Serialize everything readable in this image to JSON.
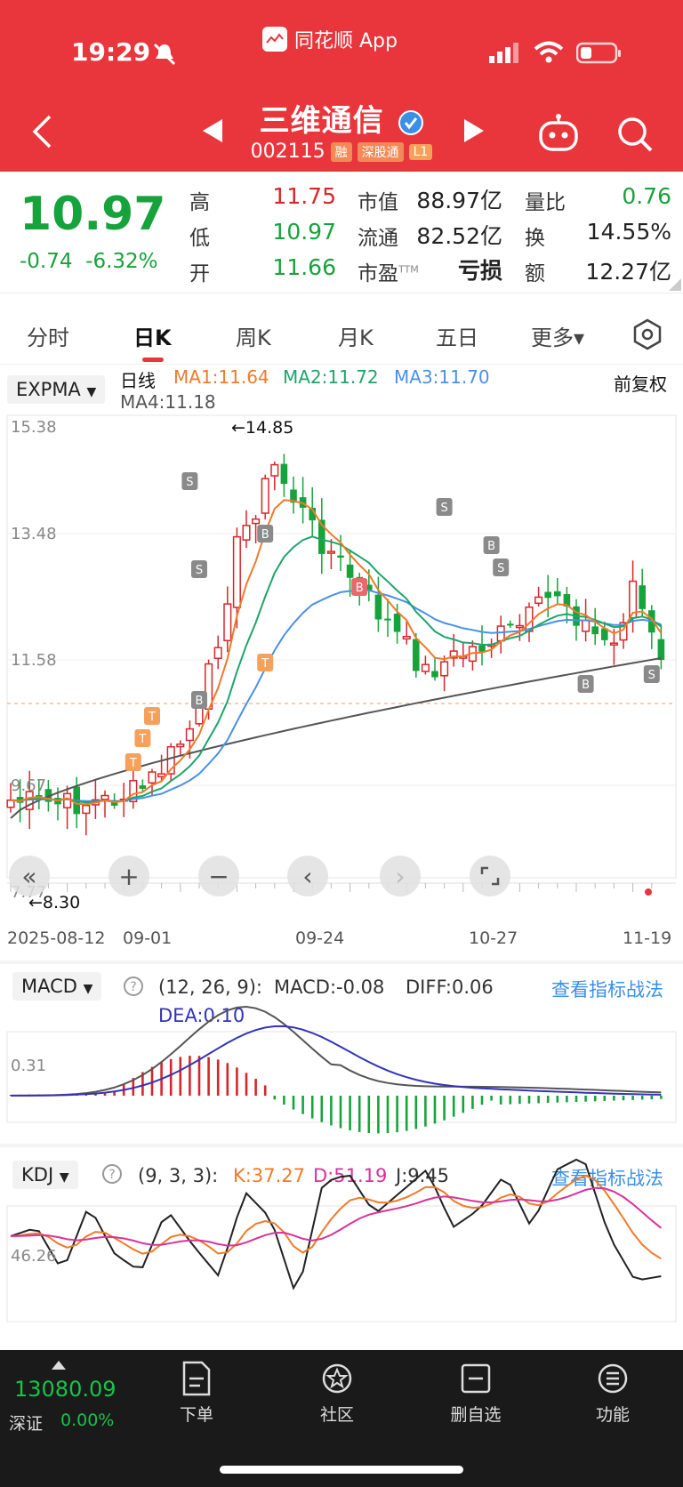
{
  "status": {
    "time": "19:29",
    "app": "同花顺 App"
  },
  "header": {
    "title": "三维通信",
    "code": "002115",
    "tags": [
      "融",
      "深股通",
      "L1"
    ]
  },
  "quote": {
    "price": "10.97",
    "change": "-0.74",
    "change_pct": "-6.32%",
    "high_label": "高",
    "high": "11.75",
    "low_label": "低",
    "low": "10.97",
    "open_label": "开",
    "open": "11.66",
    "mcap_label": "市值",
    "mcap": "88.97亿",
    "float_label": "流通",
    "float": "82.52亿",
    "pe_label": "市盈",
    "pe_sup": "TTM",
    "pe": "亏损",
    "vr_label": "量比",
    "vr": "0.76",
    "turnover_label": "换",
    "turnover": "14.55%",
    "amount_label": "额",
    "amount": "12.27亿"
  },
  "tabs": [
    "分时",
    "日K",
    "周K",
    "月K",
    "五日",
    "更多▾"
  ],
  "kline": {
    "indicator": "EXPMA",
    "line_type": "日线",
    "ma1": "MA1:11.64",
    "ma2": "MA2:11.72",
    "ma3": "MA3:11.70",
    "ma4": "MA4:11.18",
    "adjust": "前复权",
    "high_mark": "←14.85",
    "low_mark": "←8.30",
    "yticks": [
      "15.38",
      "13.48",
      "11.58",
      "9.67",
      "7.77"
    ],
    "dates": [
      "2025-08-12",
      "09-01",
      "09-24",
      "10-27",
      "11-19"
    ]
  },
  "macd": {
    "name": "MACD",
    "params": "(12, 26, 9):",
    "macd": "MACD:-0.08",
    "diff": "DIFF:0.06",
    "dea": "DEA:0.10",
    "ytick": "0.31",
    "link": "查看指标战法"
  },
  "kdj": {
    "name": "KDJ",
    "params": "(9, 3, 3):",
    "k": "K:37.27",
    "d": "D:51.19",
    "j": "J:9.45",
    "ytick": "46.26",
    "link": "查看指标战法"
  },
  "bottom": {
    "index_value": "13080.09",
    "index_name": "深证",
    "index_pct": "0.00%",
    "nav": [
      "下单",
      "社区",
      "删自选",
      "功能"
    ]
  },
  "colors": {
    "up": "#d8252b",
    "down": "#17a33c",
    "header": "#e8363c",
    "ma1": "#f07a2a",
    "ma2": "#1ea56b",
    "ma3": "#4a90e8",
    "ma4": "#555555"
  }
}
